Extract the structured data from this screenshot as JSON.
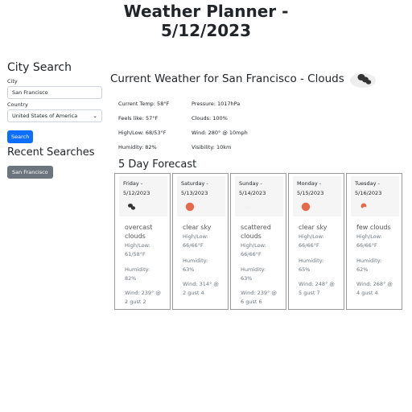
{
  "header": {
    "title_line1": "Weather Planner -",
    "title_line2": "5/12/2023"
  },
  "sidebar": {
    "heading": "City Search",
    "city_label": "City",
    "city_value": "San Francisco",
    "country_label": "Country",
    "country_value": "United States of America",
    "search_label": "Search",
    "recent_heading": "Recent Searches",
    "history": [
      "San Francisco"
    ]
  },
  "current": {
    "title": "Current Weather for San Francisco - Clouds",
    "icon": "clouds-icon",
    "temp": "Current Temp: 58°F",
    "feels": "Feels like: 57°F",
    "highlow": "High/Low: 68/53°F",
    "humidity": "Humidity: 82%",
    "pressure": "Pressure: 1017hPa",
    "clouds": "Clouds: 100%",
    "wind": "Wind: 280° @ 10mph",
    "visibility": "Visibility: 10km"
  },
  "forecast": {
    "heading": "5 Day Forecast",
    "days": [
      {
        "day": "Friday -",
        "date": "5/12/2023",
        "icon": "broken-clouds-icon",
        "desc": "overcast clouds",
        "hl_label": "High/Low:",
        "hl": "61/58°F",
        "hum_label": "Humidity:",
        "hum": "82%",
        "wind": "Wind: 239° @",
        "gust": "2 gust 2"
      },
      {
        "day": "Saturday -",
        "date": "5/13/2023",
        "icon": "sun-icon",
        "desc": "clear sky",
        "hl_label": "High/Low:",
        "hl": "66/66°F",
        "hum_label": "Humidity:",
        "hum": "63%",
        "wind": "Wind: 314° @",
        "gust": "2 gust 4"
      },
      {
        "day": "Sunday -",
        "date": "5/14/2023",
        "icon": "scattered-clouds-icon",
        "desc": "scattered clouds",
        "hl_label": "High/Low:",
        "hl": "66/66°F",
        "hum_label": "Humidity:",
        "hum": "63%",
        "wind": "Wind: 239° @",
        "gust": "6 gust 6"
      },
      {
        "day": "Monday -",
        "date": "5/15/2023",
        "icon": "sun-icon",
        "desc": "clear sky",
        "hl_label": "High/Low:",
        "hl": "66/66°F",
        "hum_label": "Humidity:",
        "hum": "65%",
        "wind": "Wind: 248° @",
        "gust": "5 gust 7"
      },
      {
        "day": "Tuesday -",
        "date": "5/16/2023",
        "icon": "few-clouds-icon",
        "desc": "few clouds",
        "hl_label": "High/Low:",
        "hl": "66/66°F",
        "hum_label": "Humidity:",
        "hum": "62%",
        "wind": "Wind: 268° @",
        "gust": "4 gust 4"
      }
    ]
  },
  "colors": {
    "primary": "#0d6efd",
    "secondary": "#6c757d",
    "sun": "#e8694a",
    "cloud": "#333333"
  }
}
